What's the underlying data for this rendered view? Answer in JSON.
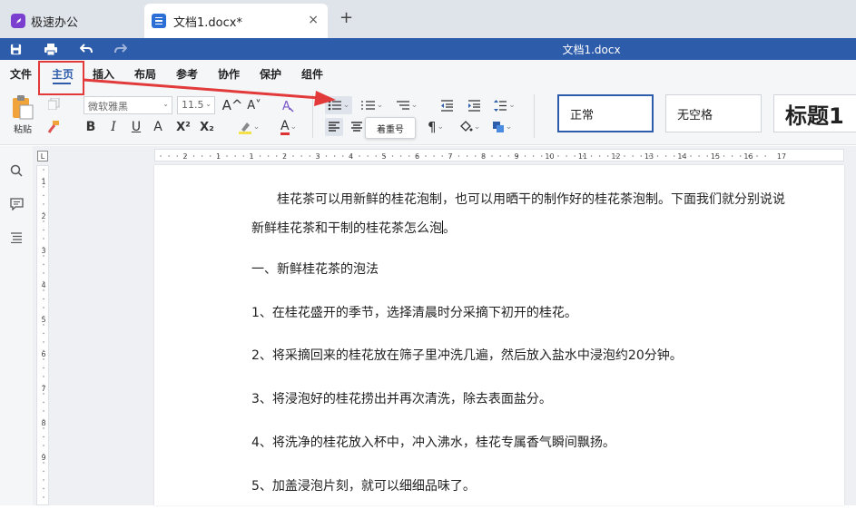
{
  "tabs": {
    "app_label": "极速办公",
    "doc_label": "文档1.docx*",
    "close": "×",
    "new": "+"
  },
  "window": {
    "title": "文档1.docx"
  },
  "menu": [
    "文件",
    "主页",
    "插入",
    "布局",
    "参考",
    "协作",
    "保护",
    "组件"
  ],
  "toolbar": {
    "paste_label": "粘贴",
    "font_name": "微软雅黑",
    "font_size": "11.5",
    "grow_font": "A^",
    "shrink_font": "A˅",
    "bold": "B",
    "italic": "I",
    "underline": "U",
    "strikethrough": "A",
    "superscript": "X²",
    "subscript": "X₂",
    "font_color": "A",
    "tooltip": "着重号"
  },
  "styles": [
    "正常",
    "无空格",
    "标题1"
  ],
  "document": {
    "paragraphs": [
      "　　桂花茶可以用新鲜的桂花泡制，也可以用晒干的制作好的桂花茶泡制。下面我们就分别说说新鲜桂花茶和干制的桂花茶怎么泡",
      "一、新鲜桂花茶的泡法",
      "1、在桂花盛开的季节，选择清晨时分采摘下初开的桂花。",
      "2、将采摘回来的桂花放在筛子里冲洗几遍，然后放入盐水中浸泡约20分钟。",
      "3、将浸泡好的桂花捞出并再次清洗，除去表面盐分。",
      "4、将洗净的桂花放入杯中，冲入沸水，桂花专属香气瞬间飘扬。",
      "5、加盖浸泡片刻，就可以细细品味了。"
    ],
    "para1_end": "。"
  },
  "ruler": {
    "h_marks": [
      "2",
      "1",
      "1",
      "2",
      "3",
      "4",
      "5",
      "6",
      "7",
      "8",
      "9",
      "10",
      "11",
      "12",
      "13",
      "14",
      "15",
      "16",
      "17"
    ],
    "v_marks": [
      "1",
      "2",
      "3",
      "4",
      "5",
      "6",
      "7",
      "8",
      "9"
    ],
    "corner": "L"
  },
  "colors": {
    "accent": "#2d5cab",
    "highlight": "#e23a3a",
    "app_logo": "#7b3fd0",
    "doc_icon": "#2b6fd6"
  }
}
